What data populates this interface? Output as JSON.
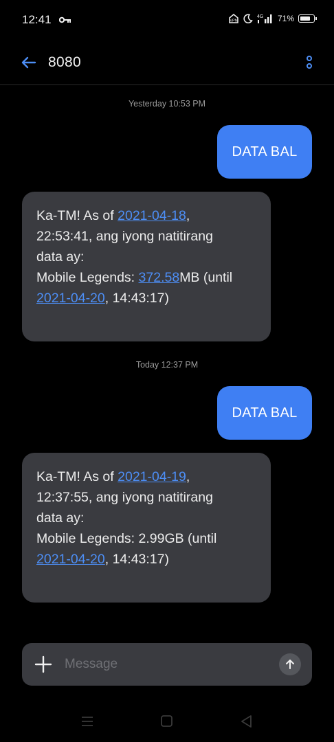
{
  "status_bar": {
    "time": "12:41",
    "network": "4G",
    "battery_percent": "71%",
    "icons": [
      "key-icon",
      "vpn-icon",
      "do-not-disturb-icon",
      "signal-icon",
      "battery-icon"
    ]
  },
  "header": {
    "title": "8080",
    "back_icon": "arrow-left-icon",
    "menu_icon": "more-vertical-icon"
  },
  "thread": {
    "groups": [
      {
        "timestamp": "Yesterday 10:53 PM",
        "sent": "DATA BAL",
        "received": {
          "l1_a": "Ka-TM! As of ",
          "l1_link": "2021-04-18",
          "l1_b": ",",
          "l2": "22:53:41, ang iyong natitirang",
          "l3": "data ay:",
          "l4_a": "Mobile Legends: ",
          "l4_link": "372.58",
          "l4_b": "MB (until",
          "l5_link": "2021-04-20",
          "l5_b": ", 14:43:17)"
        }
      },
      {
        "timestamp": "Today 12:37 PM",
        "sent": "DATA BAL",
        "received": {
          "l1_a": "Ka-TM! As of ",
          "l1_link": "2021-04-19",
          "l1_b": ",",
          "l2": "12:37:55, ang iyong natitirang",
          "l3": "data ay:",
          "l4": "Mobile Legends: 2.99GB (until",
          "l5_link": "2021-04-20",
          "l5_b": ", 14:43:17)"
        }
      }
    ]
  },
  "composer": {
    "placeholder": "Message",
    "value": "",
    "attach_icon": "plus-icon",
    "send_icon": "arrow-up-icon"
  },
  "nav_bar": {
    "icons": [
      "menu-lines-icon",
      "home-square-icon",
      "back-triangle-icon"
    ]
  },
  "colors": {
    "background": "#000000",
    "sent_bubble": "#3f7ff3",
    "received_bubble": "#3a3b40",
    "link": "#4d8ef5",
    "accent_icon": "#4d8ef5"
  }
}
